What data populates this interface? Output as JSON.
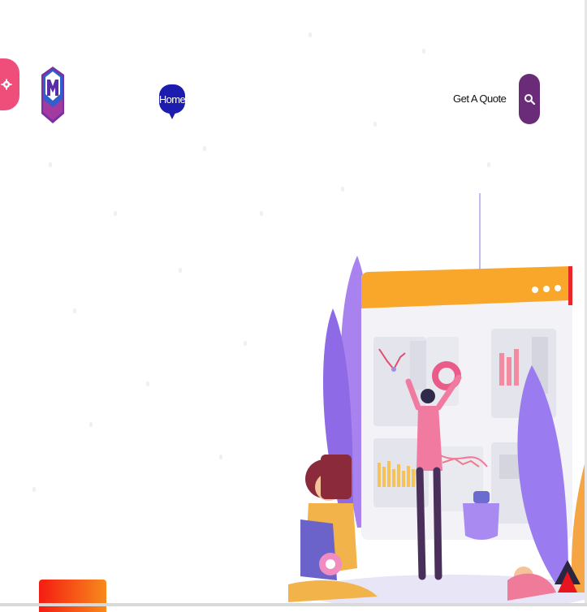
{
  "header": {
    "logo_icon": "m-hexagon-logo",
    "nav": {
      "home_label": "Home"
    },
    "quote_label": "Get A Quote",
    "search_icon": "search-icon"
  },
  "settings_icon": "gear-icon",
  "hero": {
    "illustration": "person-analyzing-dashboard",
    "cta_label": ""
  },
  "scroll_top_icon": "arrow-up-icon",
  "colors": {
    "accent_pink": "#f04e7a",
    "nav_blue": "#1c1cae",
    "search_purple": "#6a2c78",
    "cta_start": "#f41c12",
    "cta_end": "#f78a1c",
    "dashboard_orange": "#f9a72b"
  }
}
